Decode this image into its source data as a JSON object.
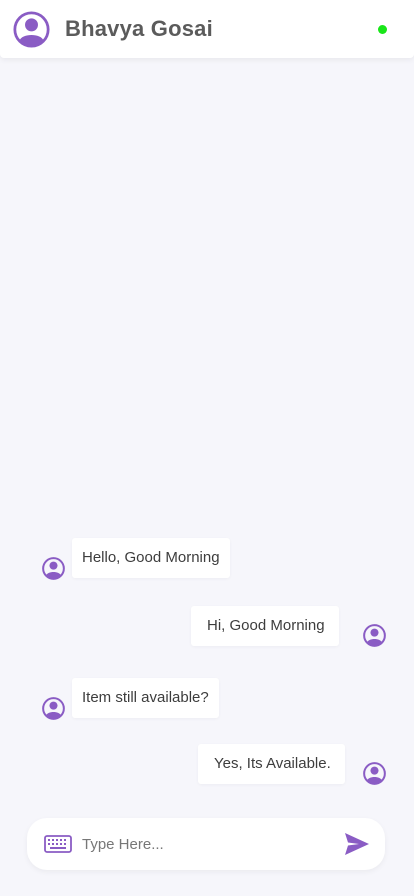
{
  "header": {
    "contact_name": "Bhavya Gosai",
    "online_status_color": "#19e619",
    "avatar_icon": "user-circle-icon"
  },
  "messages": [
    {
      "text": "Hello, Good Morning",
      "direction": "incoming"
    },
    {
      "text": "Hi, Good Morning",
      "direction": "outgoing"
    },
    {
      "text": "Item still available?",
      "direction": "incoming"
    },
    {
      "text": "Yes, Its Available.",
      "direction": "outgoing"
    }
  ],
  "composer": {
    "placeholder": "Type Here...",
    "value": "",
    "keyboard_icon": "keyboard-icon",
    "send_icon": "send-icon"
  },
  "colors": {
    "accent": "#8a5cc4",
    "background": "#f6f6fb",
    "bubble": "#ffffff"
  }
}
